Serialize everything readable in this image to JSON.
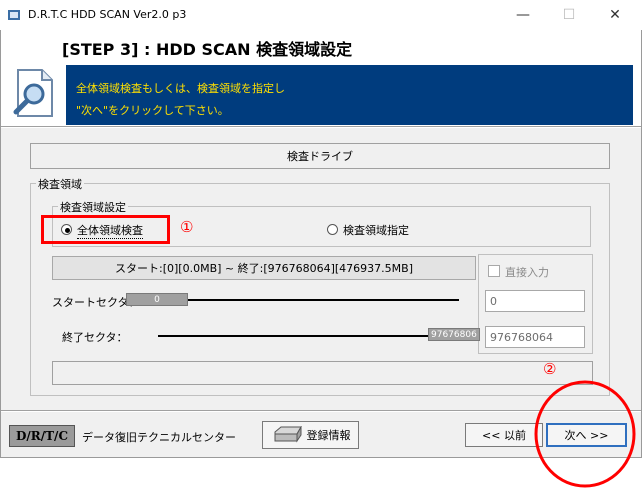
{
  "window": {
    "title": "D.R.T.C HDD SCAN Ver2.0 p3",
    "minimize_glyph": "—",
    "maximize_glyph": "☐",
    "close_glyph": "✕"
  },
  "header": {
    "step_title": "[STEP 3] : HDD SCAN  検査領域設定",
    "instruction_line1": "全体領域検査もしくは、検査領域を指定し",
    "instruction_line2": "\"次へ\"をクリックして下さい。",
    "icon": "magnifier-icon"
  },
  "drive": {
    "label": "検査ドライブ"
  },
  "scan_area": {
    "group_label": "検査領域",
    "settings_label": "検査領域設定",
    "options": [
      {
        "label": "全体領域検査",
        "selected": true
      },
      {
        "label": "検査領域指定",
        "selected": false
      }
    ],
    "range_text": "スタート:[0][0.0MB] ~ 終了:[976768064][476937.5MB]",
    "direct_input_label": "直接入力",
    "direct_input_checked": false,
    "start_sector_label": "スタートセクタ：",
    "start_slider_value": "0",
    "start_input_value": "0",
    "end_sector_label": "終了セクタ：",
    "end_slider_value": "97676806",
    "end_input_value": "976768064"
  },
  "annotations": {
    "marker1": "①",
    "marker2": "②",
    "color": "#ff0000"
  },
  "footer": {
    "logo_text": "D/R/T/C",
    "company": "データ復旧テクニカルセンター",
    "register_button": "登録情報",
    "back_button": "<< 以前",
    "next_button": "次へ >>"
  },
  "colors": {
    "panel_blue": "#003c7e",
    "instruction_text": "#ffe000",
    "window_bg": "#f0f0f0"
  }
}
